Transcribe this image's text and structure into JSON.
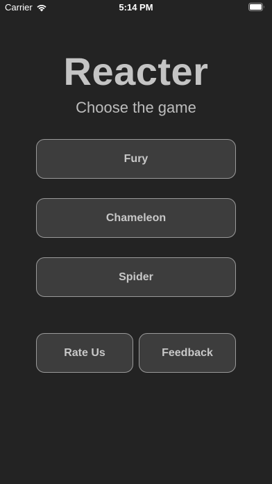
{
  "status_bar": {
    "carrier": "Carrier",
    "time": "5:14 PM"
  },
  "header": {
    "title": "Reacter",
    "subtitle": "Choose the game"
  },
  "games": [
    {
      "label": "Fury"
    },
    {
      "label": "Chameleon"
    },
    {
      "label": "Spider"
    }
  ],
  "actions": {
    "rate_label": "Rate Us",
    "feedback_label": "Feedback"
  },
  "colors": {
    "background": "#232323",
    "button_fill": "#3d3d3d",
    "button_border": "#9a9a9a",
    "text": "#c8c8c8"
  },
  "icons": [
    "wifi-icon",
    "battery-icon"
  ]
}
